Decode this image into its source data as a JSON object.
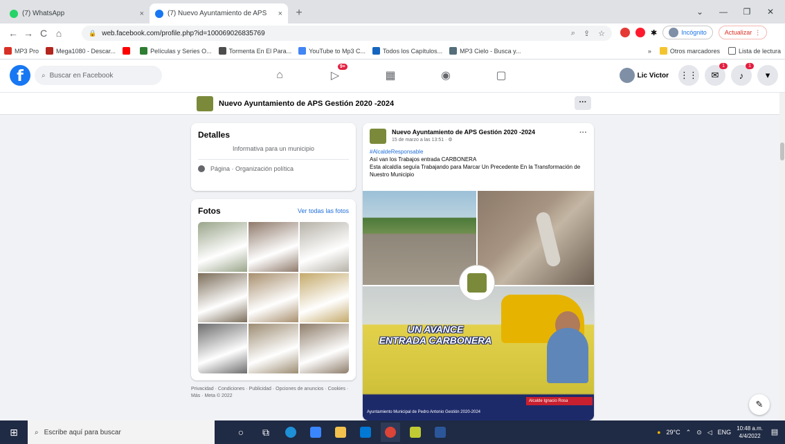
{
  "browser": {
    "tabs": [
      {
        "title": "(7) WhatsApp",
        "close": "×"
      },
      {
        "title": "(7) Nuevo Ayuntamiento de APS",
        "close": "×"
      }
    ],
    "new_tab": "+",
    "window_controls": [
      "⌄",
      "—",
      "❐",
      "✕"
    ],
    "url": "web.facebook.com/profile.php?id=100069026835769",
    "incognito_label": "Incógnito",
    "update_label": "Actualizar"
  },
  "bookmarks": {
    "items": [
      "MP3 Pro",
      "Mega1080 - Descar...",
      "",
      "Películas y Series O...",
      "Tormenta En El Para...",
      "YouTube to Mp3 C...",
      "Todos los Capítulos...",
      "MP3 Cielo - Busca y..."
    ],
    "colors": [
      "#d93025",
      "#b3261e",
      "#ff0000",
      "#2e7d32",
      "#4d4d4d",
      "#4285f4",
      "#1565c0",
      "#546e7a"
    ],
    "more": "»",
    "other": "Otros marcadores",
    "reading": "Lista de lectura"
  },
  "facebook": {
    "search_placeholder": "Buscar en Facebook",
    "watch_badge": "9+",
    "profile_name": "Lic Victor",
    "messenger_badge": "1",
    "notif_badge": "1"
  },
  "page": {
    "name": "Nuevo Ayuntamiento de APS Gestión 2020 -2024",
    "more": "···"
  },
  "details": {
    "title": "Detalles",
    "description": "Informativa para un municipio",
    "category": "Página · Organización política"
  },
  "photos": {
    "title": "Fotos",
    "see_all": "Ver todas las fotos",
    "tiles": [
      "#9aa58a",
      "#8f7a6b",
      "#b6b2a8",
      "#7c6e5a",
      "#a88f6e",
      "#c4a96a",
      "#6d6d6d",
      "#9c8c72",
      "#8e7d6a"
    ]
  },
  "footer": "Privacidad · Condiciones · Publicidad · Opciones de anuncios · Cookies · Más · Meta © 2022",
  "post": {
    "author": "Nuevo Ayuntamiento de APS Gestión 2020 -2024",
    "date": "15 de marzo a las 13:51 · ⚙",
    "hashtag": "#AlcaldeResponsable",
    "line1": "Así van los Trabajos entrada CARBONERA",
    "line2": "Esta alcaldía seguía Trabajando para Marcar Un Precedente En la Transformación de Nuestro Municipio",
    "caption_line1": "UN AVANCE",
    "caption_line2": "ENTRADA CARBONERA",
    "red_tag": "Alcalde Ignacio Rosa",
    "bottom_tag": "Ayuntamiento Municipal de Pedro Antonio  Gestión 2020-2024"
  },
  "taskbar": {
    "search_placeholder": "Escribe aquí para buscar",
    "temperature": "29°C",
    "lang": "ENG",
    "time": "10:48 a.m.",
    "date": "4/4/2022"
  }
}
